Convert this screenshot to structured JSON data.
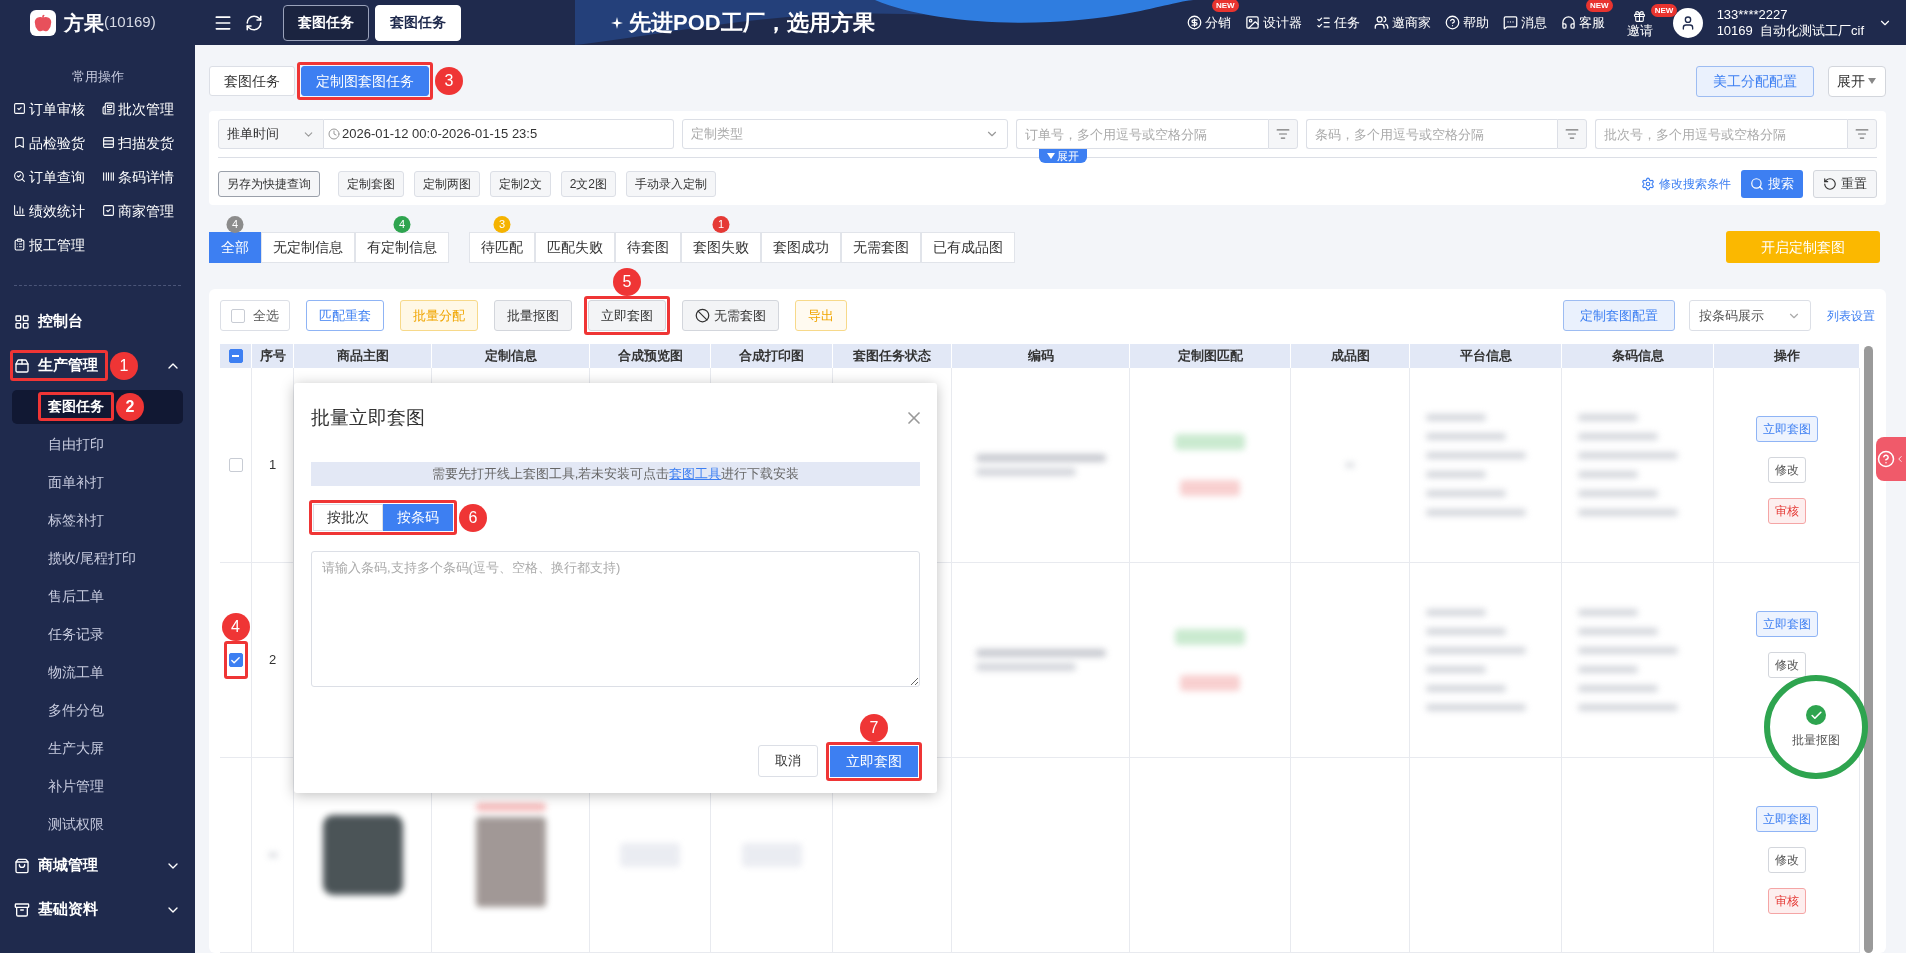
{
  "app": {
    "logo_name": "方果",
    "logo_id": "(10169)"
  },
  "header": {
    "tabs": [
      {
        "label": "套图任务",
        "selected": false
      },
      {
        "label": "套图任务",
        "selected": true
      }
    ],
    "slogan": "先进POD工厂，选用方果",
    "links": [
      {
        "label": "分销",
        "badge": "NEW"
      },
      {
        "label": "设计器"
      },
      {
        "label": "任务"
      },
      {
        "label": "邀商家"
      },
      {
        "label": "帮助"
      },
      {
        "label": "消息"
      },
      {
        "label": "客服",
        "badge": "NEW"
      }
    ],
    "invite": {
      "label": "邀请",
      "badge": "NEW"
    },
    "user": {
      "phone": "133****2227",
      "company": "10169  自动化测试工厂cif"
    }
  },
  "sidebar": {
    "quick_title": "常用操作",
    "quick_links": [
      "订单审核",
      "批次管理",
      "品检验货",
      "扫描发货",
      "订单查询",
      "条码详情",
      "绩效统计",
      "商家管理",
      "报工管理"
    ],
    "menu": [
      {
        "label": "控制台",
        "kind": "link"
      },
      {
        "label": "生产管理",
        "kind": "group",
        "expanded": true,
        "callout": "1",
        "children": [
          {
            "label": "套图任务",
            "selected": true,
            "callout": "2"
          },
          {
            "label": "自由打印",
            "selected": false
          },
          {
            "label": "面单补打",
            "selected": false
          },
          {
            "label": "标签补打",
            "selected": false
          },
          {
            "label": "揽收/尾程打印",
            "selected": false
          },
          {
            "label": "售后工单",
            "selected": false
          },
          {
            "label": "任务记录",
            "selected": false
          },
          {
            "label": "物流工单",
            "selected": false
          },
          {
            "label": "多件分包",
            "selected": false
          },
          {
            "label": "生产大屏",
            "selected": false
          },
          {
            "label": "补片管理",
            "selected": false
          },
          {
            "label": "测试权限",
            "selected": false
          }
        ]
      },
      {
        "label": "商城管理",
        "kind": "group",
        "expanded": false
      },
      {
        "label": "基础资料",
        "kind": "group",
        "expanded": false
      }
    ]
  },
  "sub_tabs": [
    {
      "label": "套图任务",
      "selected": false
    },
    {
      "label": "定制图套图任务",
      "selected": true,
      "callout": "3"
    }
  ],
  "top_actions": {
    "config_button": "美工分配配置",
    "expand_button": "展开"
  },
  "filters": {
    "time_type": "推单时间",
    "date_start": "2026-01-12 00:0",
    "date_sep": "-",
    "date_end": "2026-01-15 23:5",
    "custom_type_placeholder": "定制类型",
    "inputs": [
      {
        "placeholder": "订单号，多个用逗号或空格分隔"
      },
      {
        "placeholder": "条码，多个用逗号或空格分隔"
      },
      {
        "placeholder": "批次号，多个用逗号或空格分隔"
      }
    ],
    "quick_queries": [
      "另存为快捷查询",
      "定制套图",
      "定制两图",
      "定制2文",
      "2文2图",
      "手动录入定制"
    ],
    "expand_toggle": "展开",
    "edit_conditions": "修改搜索条件",
    "search": "搜索",
    "reset": "重置"
  },
  "status_tabs_primary": [
    {
      "label": "全部",
      "selected": true,
      "count": "4",
      "color": "#8c8c8c"
    },
    {
      "label": "无定制信息",
      "selected": false
    },
    {
      "label": "有定制信息",
      "selected": false,
      "count": "4",
      "color": "#2ea44f"
    }
  ],
  "status_tabs_secondary": [
    {
      "label": "待匹配",
      "selected": false,
      "count": "3",
      "color": "#f5b301"
    },
    {
      "label": "匹配失败",
      "selected": false
    },
    {
      "label": "待套图",
      "selected": false
    },
    {
      "label": "套图失败",
      "selected": false,
      "count": "1",
      "color": "#e53935"
    },
    {
      "label": "套图成功",
      "selected": false
    },
    {
      "label": "无需套图",
      "selected": false
    },
    {
      "label": "已有成品图",
      "selected": false
    }
  ],
  "start_button": "开启定制套图",
  "toolbar": {
    "select_all": {
      "label": "全选",
      "checked": false
    },
    "buttons": [
      {
        "label": "匹配重套",
        "kind": "primary-outline"
      },
      {
        "label": "批量分配",
        "kind": "warning"
      },
      {
        "label": "批量抠图",
        "kind": "default"
      },
      {
        "label": "立即套图",
        "kind": "default",
        "callout": "5"
      },
      {
        "label": "无需套图",
        "kind": "ban"
      },
      {
        "label": "导出",
        "kind": "warning-outline"
      }
    ],
    "config_button": "定制套图配置",
    "display_select": "按条码展示",
    "list_settings": "列表设置"
  },
  "table": {
    "header_indeterminate": true,
    "columns": [
      "序号",
      "商品主图",
      "定制信息",
      "合成预览图",
      "合成打印图",
      "套图任务状态",
      "编码",
      "定制图匹配",
      "成品图",
      "平台信息",
      "条码信息",
      "操作"
    ],
    "rows": [
      {
        "number": "1",
        "checked": false,
        "actions": [
          {
            "label": "立即套图",
            "kind": "primary"
          },
          {
            "label": "修改",
            "kind": "default"
          },
          {
            "label": "审核",
            "kind": "danger"
          }
        ]
      },
      {
        "number": "2",
        "checked": true,
        "callout": "4",
        "actions": [
          {
            "label": "立即套图",
            "kind": "primary"
          },
          {
            "label": "修改",
            "kind": "default"
          }
        ]
      },
      {
        "actions": [
          {
            "label": "立即套图",
            "kind": "primary"
          },
          {
            "label": "修改",
            "kind": "default"
          },
          {
            "label": "审核",
            "kind": "danger"
          }
        ]
      }
    ]
  },
  "float_button": {
    "label": "批量抠图"
  },
  "dialog": {
    "title": "批量立即套图",
    "notice_before": "需要先打开线上套图工具,若未安装可点击",
    "notice_link": "套图工具",
    "notice_after": "进行下载安装",
    "modes": [
      {
        "label": "按批次",
        "selected": false
      },
      {
        "label": "按条码",
        "selected": true
      }
    ],
    "modes_callout": "6",
    "textarea_placeholder": "请输入条码,支持多个条码(逗号、空格、换行都支持)",
    "cancel": "取消",
    "confirm": {
      "label": "立即套图",
      "callout": "7"
    }
  }
}
